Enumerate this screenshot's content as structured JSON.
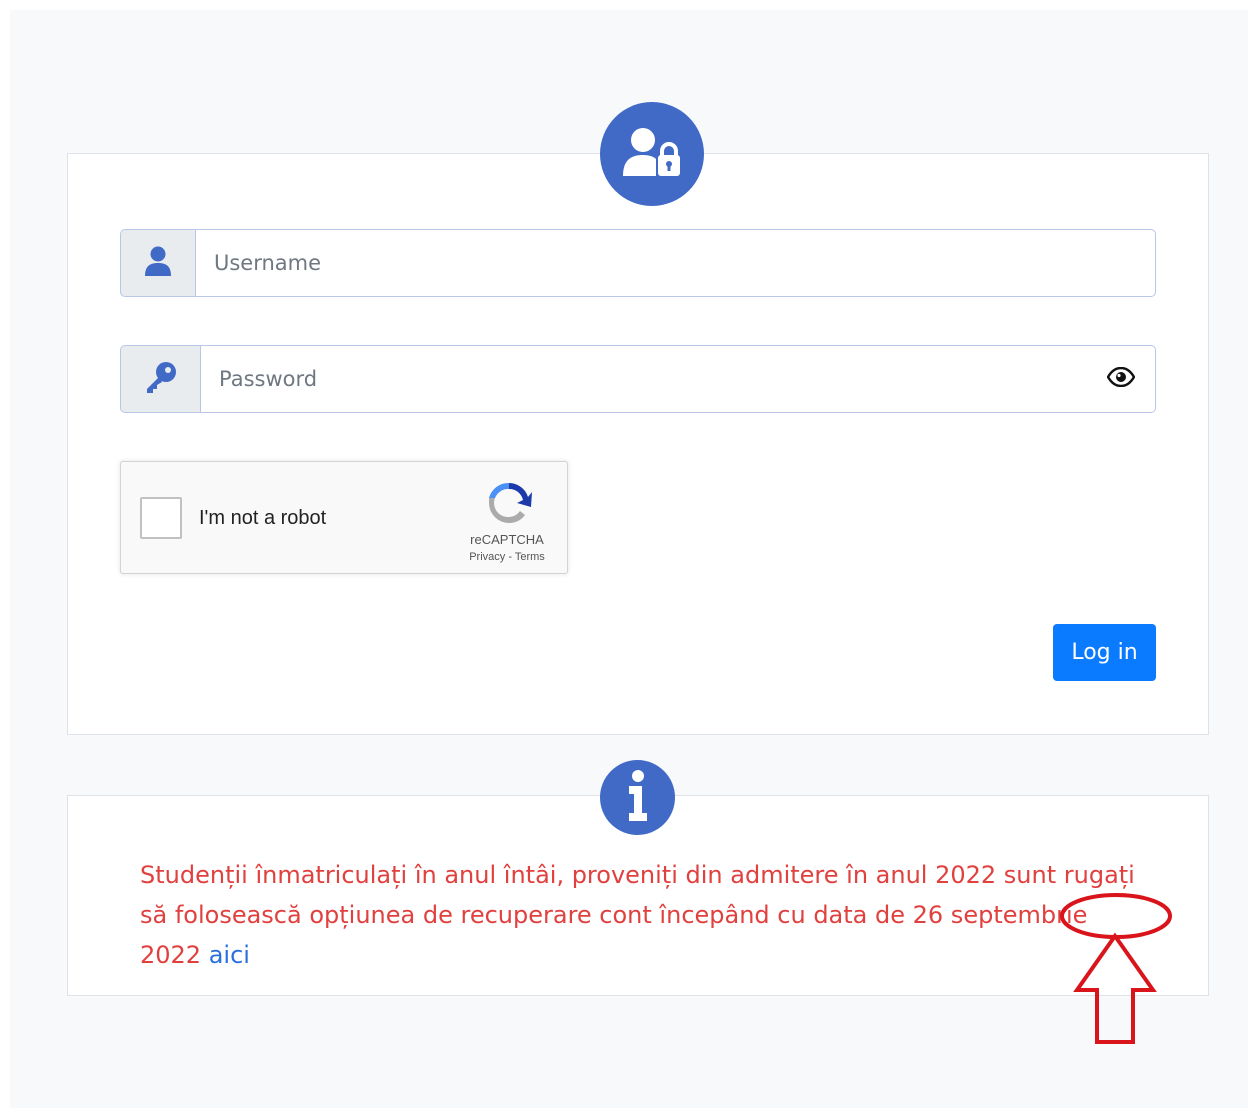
{
  "login": {
    "username_placeholder": "Username",
    "password_placeholder": "Password",
    "login_label": "Log in"
  },
  "recaptcha": {
    "checkbox_label": "I'm not a robot",
    "brand": "reCAPTCHA",
    "privacy": "Privacy",
    "separator": " - ",
    "terms": "Terms"
  },
  "info": {
    "message": "Studenții înmatriculați în anul întâi, proveniți din admitere în anul 2022 sunt rugați să folosească opțiunea de recuperare cont începând cu data de 26 septembrie 2022 ",
    "link_text": "aici"
  },
  "colors": {
    "badge": "#4169c6",
    "primary_button": "#0a7bff",
    "info_text": "#e0413f",
    "link": "#2a6fe0",
    "annotation": "#d9151b"
  },
  "icons": {
    "login_badge": "user-lock-icon",
    "username": "user-icon",
    "password": "key-icon",
    "toggle_password": "eye-icon",
    "info_badge": "info-icon",
    "recaptcha": "recaptcha-logo"
  }
}
